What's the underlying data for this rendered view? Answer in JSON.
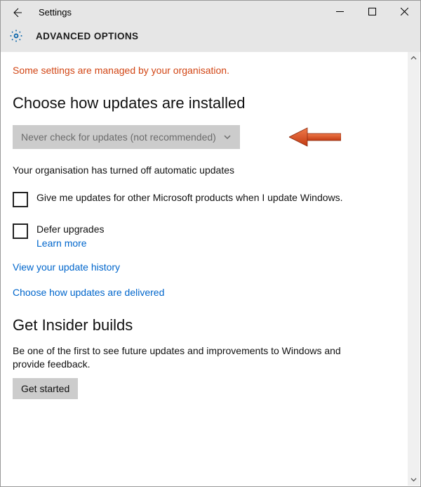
{
  "titlebar": {
    "app_title": "Settings"
  },
  "subheader": {
    "title": "ADVANCED OPTIONS"
  },
  "warning_text": "Some settings are managed by your organisation.",
  "section_updates": {
    "title": "Choose how updates are installed",
    "dropdown_value": "Never check for updates (not recommended)",
    "org_note": "Your organisation has turned off automatic updates",
    "checkbox_other_products": "Give me updates for other Microsoft products when I update Windows.",
    "checkbox_defer": "Defer upgrades",
    "learn_more": "Learn more",
    "link_history": "View your update history",
    "link_delivery": "Choose how updates are delivered"
  },
  "section_insider": {
    "title": "Get Insider builds",
    "description": "Be one of the first to see future updates and improvements to Windows and provide feedback.",
    "button": "Get started"
  },
  "annotation": {
    "arrow_color": "#e2562a"
  }
}
